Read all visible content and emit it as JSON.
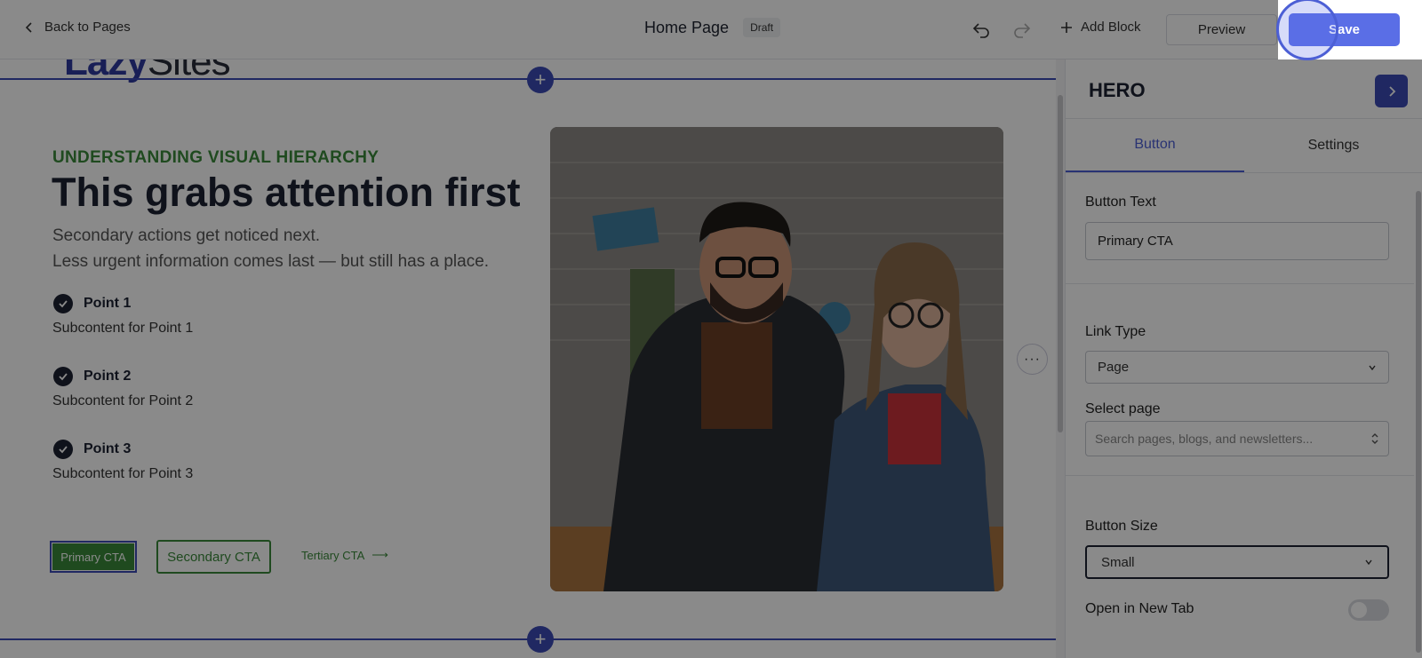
{
  "topbar": {
    "back_label": "Back to Pages",
    "page_title": "Home Page",
    "status_badge": "Draft",
    "add_block_label": "Add Block",
    "preview_label": "Preview",
    "save_label": "Save"
  },
  "canvas": {
    "logo_bold": "Lazy",
    "logo_light": "Sites",
    "eyebrow": "UNDERSTANDING VISUAL HIERARCHY",
    "headline": "This grabs attention first",
    "subtext_line1": "Secondary actions get noticed next.",
    "subtext_line2": "Less urgent information comes last — but still has a place.",
    "points": [
      {
        "title": "Point 1",
        "sub": "Subcontent for Point 1"
      },
      {
        "title": "Point 2",
        "sub": "Subcontent for Point 2"
      },
      {
        "title": "Point 3",
        "sub": "Subcontent for Point 3"
      }
    ],
    "primary_cta": "Primary CTA",
    "secondary_cta": "Secondary CTA",
    "tertiary_cta": "Tertiary CTA",
    "tertiary_arrow": "⟶",
    "more_glyph": "···",
    "add_glyph": "+"
  },
  "panel": {
    "title": "HERO",
    "tabs": [
      {
        "label": "Button",
        "active": true
      },
      {
        "label": "Settings",
        "active": false
      }
    ],
    "button_text_label": "Button Text",
    "button_text_value": "Primary CTA",
    "link_type_label": "Link Type",
    "link_type_value": "Page",
    "select_page_label": "Select page",
    "select_page_placeholder": "Search pages, blogs, and newsletters...",
    "button_size_label": "Button Size",
    "button_size_value": "Small",
    "new_tab_label": "Open in New Tab",
    "new_tab_on": false
  },
  "colors": {
    "accent": "#5a6ee6",
    "brand_blue": "#3b4bb5",
    "green": "#3a8a3a",
    "dark": "#1d2233"
  },
  "icons": [
    "chevron-left-icon",
    "undo-icon",
    "redo-icon",
    "plus-icon",
    "chevron-right-icon",
    "check-icon",
    "chevron-down-icon",
    "arrow-right-icon",
    "more-horizontal-icon",
    "updown-icon"
  ]
}
